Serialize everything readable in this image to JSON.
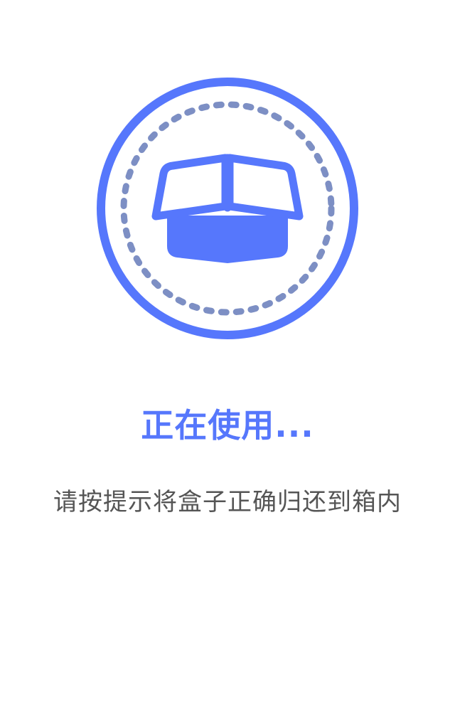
{
  "colors": {
    "accent": "#5677fc",
    "dotted_ring": "#7d8fc4",
    "message_text": "#555555",
    "background": "#ffffff"
  },
  "emblem": {
    "icon": "open-box-icon"
  },
  "status": {
    "title": "正在使用...",
    "message": "请按提示将盒子正确归还到箱内"
  }
}
